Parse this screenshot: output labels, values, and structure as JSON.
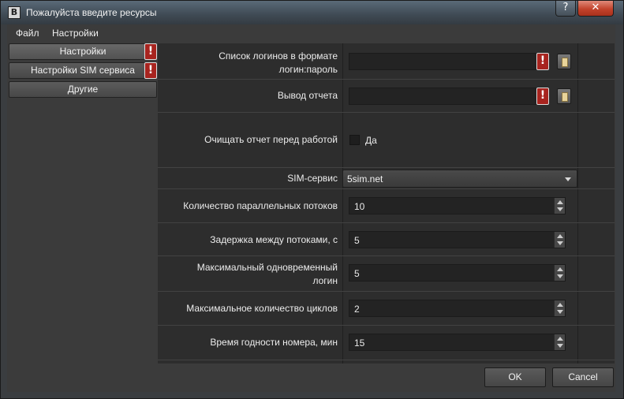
{
  "window": {
    "title": "Пожалуйста введите ресурсы",
    "app_icon": "B",
    "help_label": "?",
    "close_label": "✕"
  },
  "menu": [
    "Файл",
    "Настройки"
  ],
  "sidebar": {
    "items": [
      {
        "label": "Настройки",
        "warning": "!"
      },
      {
        "label": "Настройки SIM сервиса",
        "warning": "!"
      },
      {
        "label": "Другие"
      }
    ]
  },
  "form": {
    "logins": {
      "label_line1": "Список логинов в формате",
      "label_line2": "логин:пароль",
      "value": "",
      "warning": "!"
    },
    "report": {
      "label": "Вывод отчета",
      "value": "",
      "warning": "!"
    },
    "clear_report": {
      "label": "Очищать отчет перед работой",
      "checkbox_label": "Да",
      "checked": false
    },
    "sim_service": {
      "label": "SIM-сервис",
      "value": "5sim.net"
    },
    "threads": {
      "label": "Количество параллельных потоков",
      "value": "10"
    },
    "delay": {
      "label": "Задержка между потоками, с",
      "value": "5"
    },
    "max_login": {
      "label_line1": "Максимальный одновременный",
      "label_line2": "логин",
      "value": "5"
    },
    "max_cycles": {
      "label": "Максимальное количество циклов",
      "value": "2"
    },
    "number_ttl": {
      "label": "Время годности номера, мин",
      "value": "15"
    }
  },
  "buttons": {
    "ok": "OK",
    "cancel": "Cancel"
  },
  "colors": {
    "warning": "#a8241f",
    "close": "#c2432c",
    "background": "#3b3b3b"
  }
}
